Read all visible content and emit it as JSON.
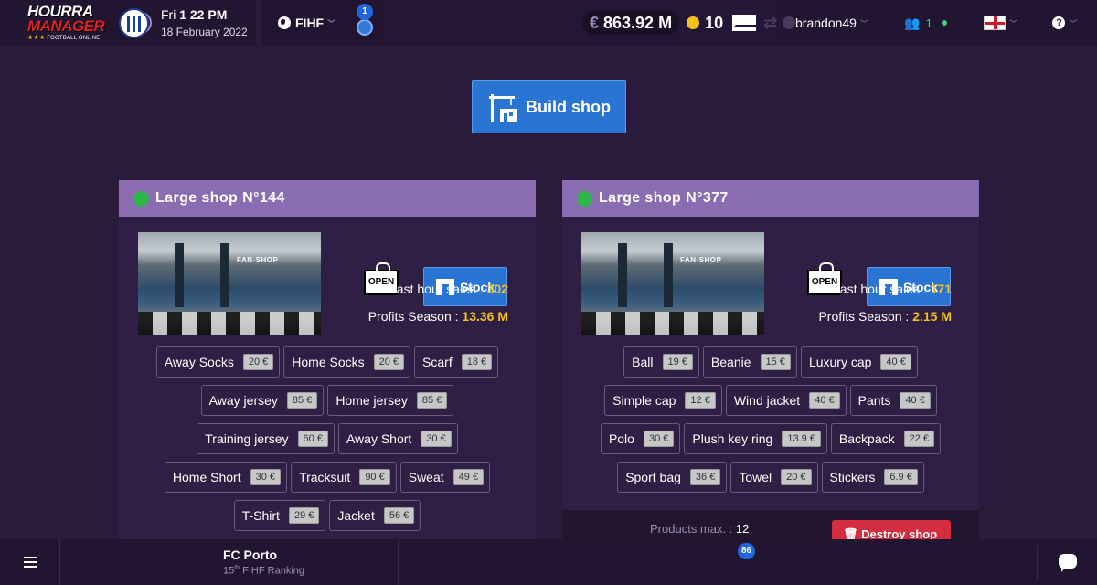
{
  "logo": {
    "line1": "HOURRA",
    "line2": "MANAGER",
    "line3": "FOOTBALL ONLINE",
    "stars": "★★★"
  },
  "clock": {
    "day": "Fri",
    "time": "1 22 PM",
    "date": "18 February 2022"
  },
  "federation": {
    "label": "FIHF"
  },
  "matches_badge": "1",
  "user": {
    "name": "brandon49"
  },
  "online": {
    "count": "1"
  },
  "help": {
    "glyph": "?"
  },
  "build_button": {
    "label": "Build shop"
  },
  "shops": [
    {
      "title": "Large shop N°144",
      "image_sign": "FAN-SHOP",
      "open_label": "OPEN",
      "stock_label": "Stock",
      "last_hour_label": "Last hour sales : ",
      "last_hour_value": "302",
      "profits_label": "Profits Season : ",
      "profits_value": "13.36 M",
      "rows": [
        [
          {
            "name": "Away Socks",
            "price": "20 €"
          },
          {
            "name": "Home Socks",
            "price": "20 €"
          },
          {
            "name": "Scarf",
            "price": "18 €"
          }
        ],
        [
          {
            "name": "Away jersey",
            "price": "85 €"
          },
          {
            "name": "Home jersey",
            "price": "85 €"
          }
        ],
        [
          {
            "name": "Training jersey",
            "price": "60 €"
          },
          {
            "name": "Away Short",
            "price": "30 €"
          }
        ],
        [
          {
            "name": "Home Short",
            "price": "30 €"
          },
          {
            "name": "Tracksuit",
            "price": "90 €"
          },
          {
            "name": "Sweat",
            "price": "49 €"
          }
        ],
        [
          {
            "name": "T-Shirt",
            "price": "29 €"
          },
          {
            "name": "Jacket",
            "price": "56 €"
          }
        ]
      ]
    },
    {
      "title": "Large shop N°377",
      "image_sign": "FAN-SHOP",
      "open_label": "OPEN",
      "stock_label": "Stock",
      "last_hour_label": "Last hour sales : ",
      "last_hour_value": "171",
      "profits_label": "Profits Season : ",
      "profits_value": "2.15 M",
      "rows": [
        [
          {
            "name": "Ball",
            "price": "19 €"
          },
          {
            "name": "Beanie",
            "price": "15 €"
          },
          {
            "name": "Luxury cap",
            "price": "40 €"
          }
        ],
        [
          {
            "name": "Simple cap",
            "price": "12 €"
          },
          {
            "name": "Wind jacket",
            "price": "40 €"
          },
          {
            "name": "Pants",
            "price": "40 €"
          }
        ],
        [
          {
            "name": "Polo",
            "price": "30 €"
          },
          {
            "name": "Plush key ring",
            "price": "13.9 €"
          },
          {
            "name": "Backpack",
            "price": "22 €"
          }
        ],
        [
          {
            "name": "Sport bag",
            "price": "36 €"
          },
          {
            "name": "Towel",
            "price": "20 €"
          },
          {
            "name": "Stickers",
            "price": "6.9 €"
          }
        ]
      ],
      "products_max_label": "Products max. : ",
      "products_max_value": "12",
      "destroy_label": "🗑 Destroy shop"
    }
  ],
  "bottom": {
    "club_name": "FC Porto",
    "club_rank_num": "15",
    "club_rank_sup": "th",
    "club_rank_text": " FIHF Ranking",
    "money_symbol": "€",
    "money_value": "863.92 M",
    "coins": "10",
    "mail_badge": "86"
  },
  "colors": {
    "accent": "#2a74d4",
    "header": "#8a6cb3",
    "status_open": "#2fb64a",
    "value": "#f2c21a",
    "danger": "#d42d3f"
  }
}
